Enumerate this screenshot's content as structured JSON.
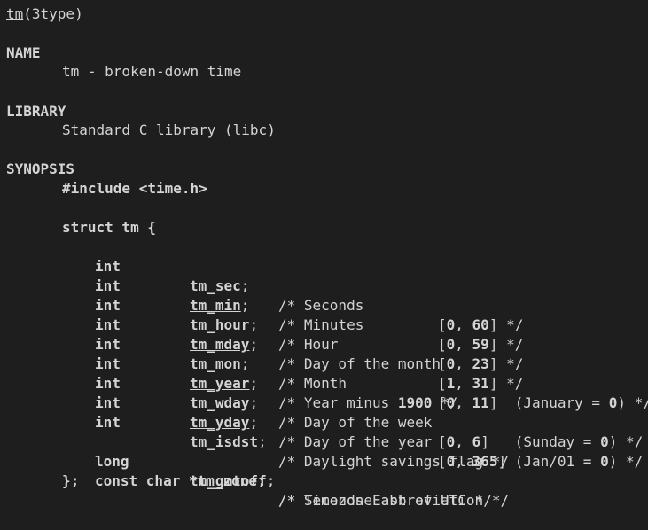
{
  "header": {
    "name": "tm",
    "section": "(3type)"
  },
  "sections": {
    "name": {
      "heading": "NAME",
      "text": "tm - broken-down time"
    },
    "library": {
      "heading": "LIBRARY",
      "prefix": "Standard C library (",
      "lib": "libc",
      "suffix": ")"
    },
    "synopsis": {
      "heading": "SYNOPSIS",
      "include": "#include <time.h>",
      "struct_open": "struct tm {",
      "struct_close": "};"
    }
  },
  "fields": [
    {
      "type": "int",
      "name": "tm_sec",
      "comment": "/* Seconds",
      "range": {
        "open": "[",
        "lo": "0",
        "sep": ", ",
        "hi": "60",
        "close": "]"
      },
      "extra": " */"
    },
    {
      "type": "int",
      "name": "tm_min",
      "comment": "/* Minutes",
      "range": {
        "open": "[",
        "lo": "0",
        "sep": ", ",
        "hi": "59",
        "close": "]"
      },
      "extra": " */"
    },
    {
      "type": "int",
      "name": "tm_hour",
      "comment": "/* Hour",
      "range": {
        "open": "[",
        "lo": "0",
        "sep": ", ",
        "hi": "23",
        "close": "]"
      },
      "extra": " */"
    },
    {
      "type": "int",
      "name": "tm_mday",
      "comment": "/* Day of the month",
      "range": {
        "open": "[",
        "lo": "1",
        "sep": ", ",
        "hi": "31",
        "close": "]"
      },
      "extra": " */"
    },
    {
      "type": "int",
      "name": "tm_mon",
      "comment": "/* Month",
      "range": {
        "open": "[",
        "lo": "0",
        "sep": ", ",
        "hi": "11",
        "close": "]"
      },
      "extra": "  (January = ",
      "extra_bold": "0",
      "extra_end": ") */"
    },
    {
      "type": "int",
      "name": "tm_year",
      "comment": "/* Year minus ",
      "comment_bold": "1900",
      "comment_end": " */"
    },
    {
      "type": "int",
      "name": "tm_wday",
      "comment": "/* Day of the week",
      "range": {
        "open": "[",
        "lo": "0",
        "sep": ", ",
        "hi": "6",
        "close": "]"
      },
      "extra": "   (Sunday = ",
      "extra_bold": "0",
      "extra_end": ") */"
    },
    {
      "type": "int",
      "name": "tm_yday",
      "comment": "/* Day of the year",
      "range": {
        "open": "[",
        "lo": "0",
        "sep": ", ",
        "hi": "365",
        "close": "]"
      },
      "extra": " (Jan/01 = ",
      "extra_bold": "0",
      "extra_end": ") */"
    },
    {
      "type": "int",
      "name": "tm_isdst",
      "comment": "/* Daylight savings flag */"
    }
  ],
  "extra_fields": [
    {
      "type": "long",
      "name": "tm_gmtoff",
      "punct": ";",
      "comment": "/* Seconds East of UTC */"
    },
    {
      "type": "const char *",
      "name": "tm_zone",
      "punct": ";",
      "comment": "/* Timezone abbreviation */"
    }
  ]
}
